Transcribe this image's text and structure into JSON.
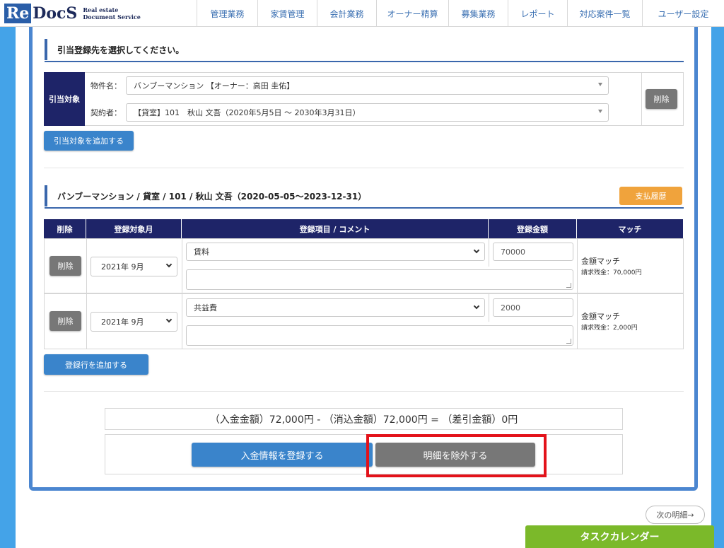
{
  "header": {
    "logo_re": "Re",
    "logo_docs": "DocS",
    "logo_line1": "Real estate",
    "logo_line2": "Document Service",
    "nav": [
      "管理業務",
      "家賃管理",
      "会計業務",
      "オーナー精算",
      "募集業務",
      "レポート",
      "対応案件一覧",
      "ユーザー設定"
    ]
  },
  "selection": {
    "title": "引当登録先を選択してください。",
    "target_label": "引当対象",
    "property_label": "物件名：",
    "property_value": "バンブーマンション 【オーナー：高田 圭佑】",
    "contractor_label": "契約者：",
    "contractor_value": "【貸室】101　秋山 文吾（2020年5月5日 〜 2030年3月31日）",
    "delete_label": "削除",
    "add_target_label": "引当対象を追加する"
  },
  "registration": {
    "title": "バンブーマンション / 貸室 / 101 / 秋山 文吾（2020-05-05〜2023-12-31）",
    "payment_history_label": "支払履歴",
    "columns": [
      "削除",
      "登録対象月",
      "登録項目 / コメント",
      "登録金額",
      "マッチ"
    ],
    "rows": [
      {
        "delete": "削除",
        "month": "2021年 9月",
        "item": "賃料",
        "comment": "",
        "amount": "70000",
        "match": "金額マッチ",
        "match_detail": "請求残金：70,000円"
      },
      {
        "delete": "削除",
        "month": "2021年 9月",
        "item": "共益費",
        "comment": "",
        "amount": "2000",
        "match": "金額マッチ",
        "match_detail": "請求残金：2,000円"
      }
    ],
    "add_row_label": "登録行を追加する"
  },
  "summary": {
    "formula": "（入金金額）72,000円 - （消込金額）72,000円 = （差引金額）0円",
    "register_label": "入金情報を登録する",
    "exclude_label": "明細を除外する"
  },
  "footer": {
    "next_label": "次の明細→",
    "task_calendar_label": "タスクカレンダー"
  },
  "colors": {
    "accent_blue": "#3a84cb",
    "table_header": "#1e2468",
    "stripe": "#44a3e8",
    "orange": "#f0a33c",
    "green": "#7bb92a",
    "highlight_red": "#e3121a"
  }
}
